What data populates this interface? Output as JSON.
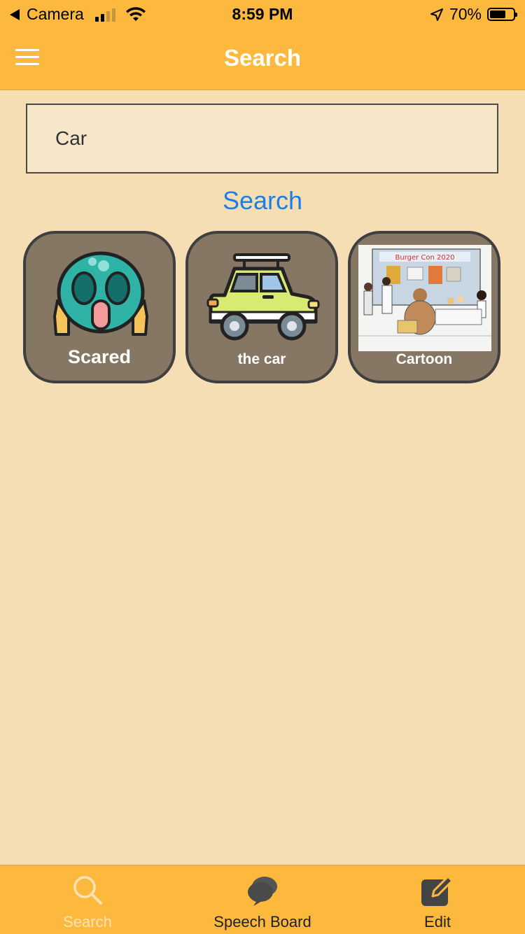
{
  "status_bar": {
    "back_app": "Camera",
    "time": "8:59 PM",
    "battery": "70%",
    "battery_level": 0.7
  },
  "nav": {
    "title": "Search",
    "menu_icon": "hamburger-menu-icon"
  },
  "search": {
    "value": "Car",
    "button_label": "Search"
  },
  "results": [
    {
      "label": "Scared",
      "icon": "scared-face-icon"
    },
    {
      "label": "the car",
      "icon": "car-icon"
    },
    {
      "label": "Cartoon",
      "icon": "cartoon-image"
    }
  ],
  "tabs": [
    {
      "label": "Search",
      "icon": "search-icon",
      "active": true
    },
    {
      "label": "Speech Board",
      "icon": "speech-bubble-icon",
      "active": false
    },
    {
      "label": "Edit",
      "icon": "edit-icon",
      "active": false
    }
  ],
  "colors": {
    "accent": "#fdb93e",
    "background": "#f6deb4",
    "tile": "#857763",
    "link": "#1c7fe8"
  }
}
